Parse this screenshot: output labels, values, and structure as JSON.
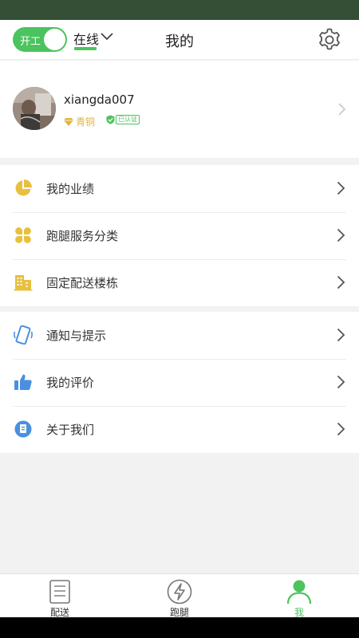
{
  "header": {
    "toggle_label": "开工",
    "status": "在线",
    "title": "我的"
  },
  "profile": {
    "username": "xiangda007",
    "level": "青铜",
    "verified": "已认证"
  },
  "groups": [
    [
      {
        "label": "我的业绩",
        "icon": "pie-chart-icon"
      },
      {
        "label": "跑腿服务分类",
        "icon": "grid-icon"
      },
      {
        "label": "固定配送楼栋",
        "icon": "building-icon"
      }
    ],
    [
      {
        "label": "通知与提示",
        "icon": "phone-vibrate-icon"
      },
      {
        "label": "我的评价",
        "icon": "thumbs-up-icon"
      },
      {
        "label": "关于我们",
        "icon": "info-icon"
      }
    ]
  ],
  "tabs": [
    {
      "label": "配送",
      "icon": "clipboard-icon",
      "active": false
    },
    {
      "label": "跑腿",
      "icon": "lightning-icon",
      "active": false
    },
    {
      "label": "我",
      "icon": "person-icon",
      "active": true
    }
  ],
  "colors": {
    "accent": "#4cc35f",
    "status_bar": "#344f36",
    "icon_yellow": "#e8c03f",
    "icon_blue": "#4a90e2"
  }
}
